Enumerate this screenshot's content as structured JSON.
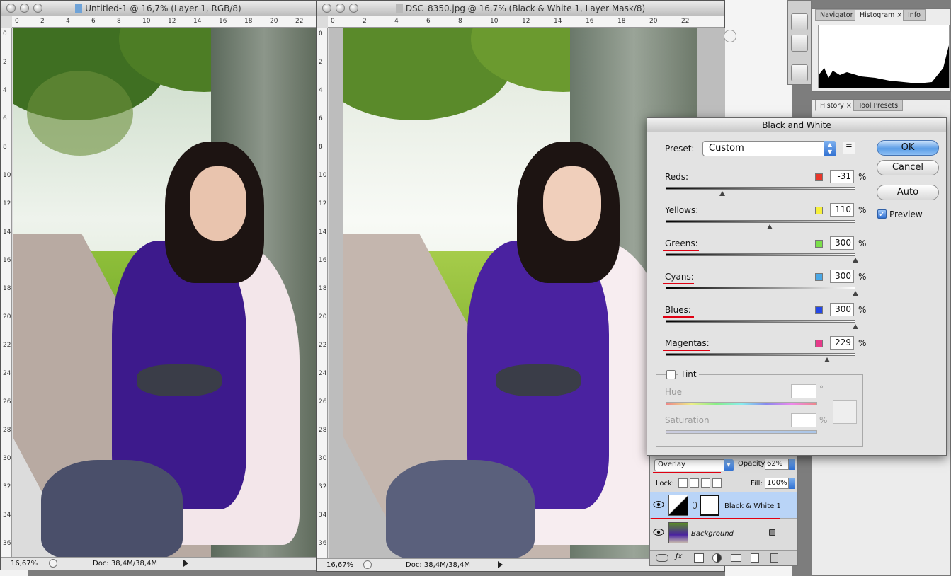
{
  "windows": [
    {
      "title": "Untitled-1 @ 16,7% (Layer 1, RGB/8)",
      "zoom": "16,67%",
      "doc": "Doc: 38,4M/38,4M"
    },
    {
      "title": "DSC_8350.jpg @ 16,7% (Black & White 1, Layer Mask/8)",
      "zoom": "16,67%",
      "doc": "Doc: 38,4M/38,4M"
    }
  ],
  "ruler": {
    "top_ticks": [
      "0",
      "2",
      "4",
      "6",
      "8",
      "10",
      "12",
      "14",
      "16",
      "18",
      "20",
      "22"
    ],
    "left_ticks": [
      "0",
      "2",
      "4",
      "6",
      "8",
      "10",
      "12",
      "14",
      "16",
      "18",
      "20",
      "22",
      "24",
      "26",
      "28",
      "30",
      "32",
      "34",
      "36"
    ]
  },
  "panels": {
    "top_tabs": [
      "Navigator",
      "Histogram",
      "Info"
    ],
    "history_tabs": [
      "History",
      "Tool Presets"
    ]
  },
  "dialog": {
    "title": "Black and White",
    "preset_label": "Preset:",
    "preset_value": "Custom",
    "buttons": {
      "ok": "OK",
      "cancel": "Cancel",
      "auto": "Auto"
    },
    "preview_label": "Preview",
    "preview_checked": true,
    "percent": "%",
    "channels": [
      {
        "label": "Reds:",
        "value": "-31",
        "color": "#e8372b",
        "level": 0.3,
        "underlined": false
      },
      {
        "label": "Yellows:",
        "value": "110",
        "color": "#f6f03c",
        "level": 0.55,
        "underlined": false
      },
      {
        "label": "Greens:",
        "value": "300",
        "color": "#7be04a",
        "level": 1.0,
        "underlined": true
      },
      {
        "label": "Cyans:",
        "value": "300",
        "color": "#4aa8e6",
        "level": 1.0,
        "underlined": true
      },
      {
        "label": "Blues:",
        "value": "300",
        "color": "#2448e8",
        "level": 1.0,
        "underlined": true
      },
      {
        "label": "Magentas:",
        "value": "229",
        "color": "#e63b8a",
        "level": 0.85,
        "underlined": true
      }
    ],
    "tint": {
      "label": "Tint",
      "hue_label": "Hue",
      "hue_unit": "°",
      "saturation_label": "Saturation",
      "saturation_unit": "%"
    }
  },
  "layers": {
    "blend_mode": "Overlay",
    "opacity_label": "Opacity:",
    "opacity_value": "62%",
    "lock_label": "Lock:",
    "fill_label": "Fill:",
    "fill_value": "100%",
    "items": [
      {
        "name": "Black & White 1"
      },
      {
        "name": "Background"
      }
    ]
  },
  "colors": {
    "accent_red": "#e00012",
    "selection": "#b9d4f7"
  }
}
